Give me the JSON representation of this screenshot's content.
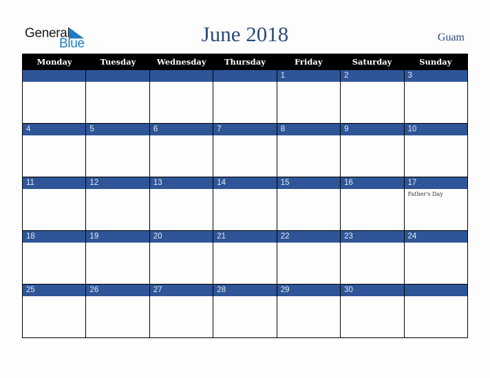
{
  "brand": {
    "line1": "General",
    "line2": "Blue",
    "accent_color": "#1f7bc4"
  },
  "title": "June 2018",
  "region": "Guam",
  "colors": {
    "header_bg": "#000000",
    "date_band": "#2e5597",
    "title": "#2b4a7a"
  },
  "weekdays": [
    "Monday",
    "Tuesday",
    "Wednesday",
    "Thursday",
    "Friday",
    "Saturday",
    "Sunday"
  ],
  "weeks": [
    [
      {
        "day": ""
      },
      {
        "day": ""
      },
      {
        "day": ""
      },
      {
        "day": ""
      },
      {
        "day": "1"
      },
      {
        "day": "2"
      },
      {
        "day": "3"
      }
    ],
    [
      {
        "day": "4"
      },
      {
        "day": "5"
      },
      {
        "day": "6"
      },
      {
        "day": "7"
      },
      {
        "day": "8"
      },
      {
        "day": "9"
      },
      {
        "day": "10"
      }
    ],
    [
      {
        "day": "11"
      },
      {
        "day": "12"
      },
      {
        "day": "13"
      },
      {
        "day": "14"
      },
      {
        "day": "15"
      },
      {
        "day": "16"
      },
      {
        "day": "17",
        "event": "Father's Day"
      }
    ],
    [
      {
        "day": "18"
      },
      {
        "day": "19"
      },
      {
        "day": "20"
      },
      {
        "day": "21"
      },
      {
        "day": "22"
      },
      {
        "day": "23"
      },
      {
        "day": "24"
      }
    ],
    [
      {
        "day": "25"
      },
      {
        "day": "26"
      },
      {
        "day": "27"
      },
      {
        "day": "28"
      },
      {
        "day": "29"
      },
      {
        "day": "30"
      },
      {
        "day": ""
      }
    ]
  ]
}
